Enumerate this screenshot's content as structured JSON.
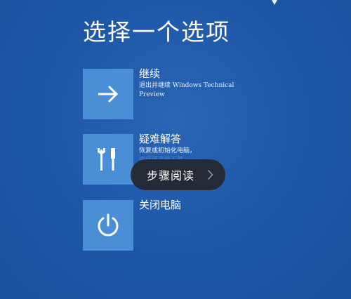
{
  "screen": {
    "title": "选择一个选项",
    "background_color": "#1f58a8",
    "tile_color": "#4a8fd5"
  },
  "options": [
    {
      "label": "继续",
      "description": "退出并继续 Windows Technical Preview",
      "icon": "arrow-right-icon"
    },
    {
      "label": "疑难解答",
      "description": "恢复或初始化电脑，",
      "description_faded": "或使用高级工具",
      "icon": "tools-icon"
    },
    {
      "label": "关闭电脑",
      "icon": "power-icon"
    }
  ],
  "toast": {
    "label": "步骤阅读",
    "icon": "chevron-right-icon"
  }
}
